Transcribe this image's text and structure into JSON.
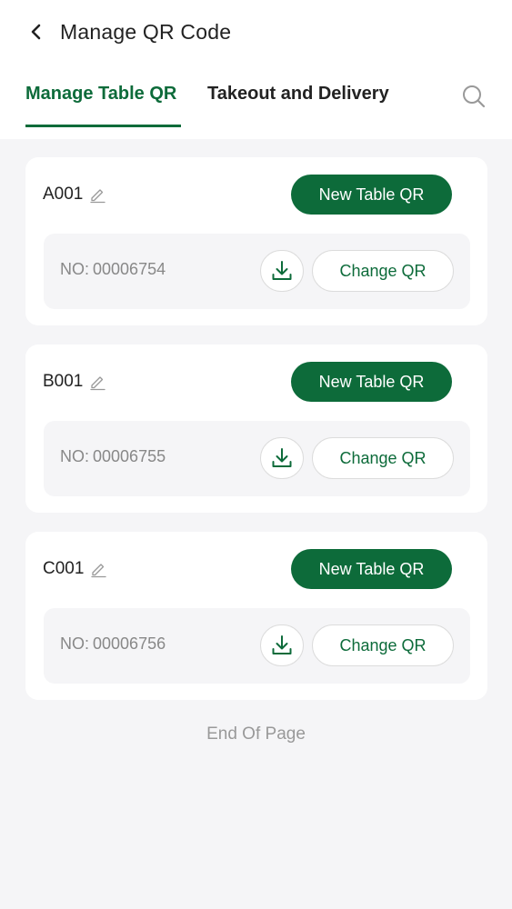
{
  "header": {
    "title": "Manage QR Code",
    "back_icon": "chevron-left-icon"
  },
  "tabs": [
    {
      "label": "Manage Table QR",
      "active": true
    },
    {
      "label": "Takeout and Delivery",
      "active": false
    }
  ],
  "search_icon": "search-icon",
  "colors": {
    "accent": "#0d6b3a",
    "background": "#f5f5f7",
    "muted_text": "#888888"
  },
  "tables": [
    {
      "name": "A001",
      "new_qr_label": "New Table QR",
      "no_label": "NO:",
      "no_value": "00006754",
      "change_label": "Change QR"
    },
    {
      "name": "B001",
      "new_qr_label": "New Table QR",
      "no_label": "NO:",
      "no_value": "00006755",
      "change_label": "Change QR"
    },
    {
      "name": "C001",
      "new_qr_label": "New Table QR",
      "no_label": "NO:",
      "no_value": "00006756",
      "change_label": "Change QR"
    }
  ],
  "footer": {
    "end_text": "End Of Page"
  }
}
